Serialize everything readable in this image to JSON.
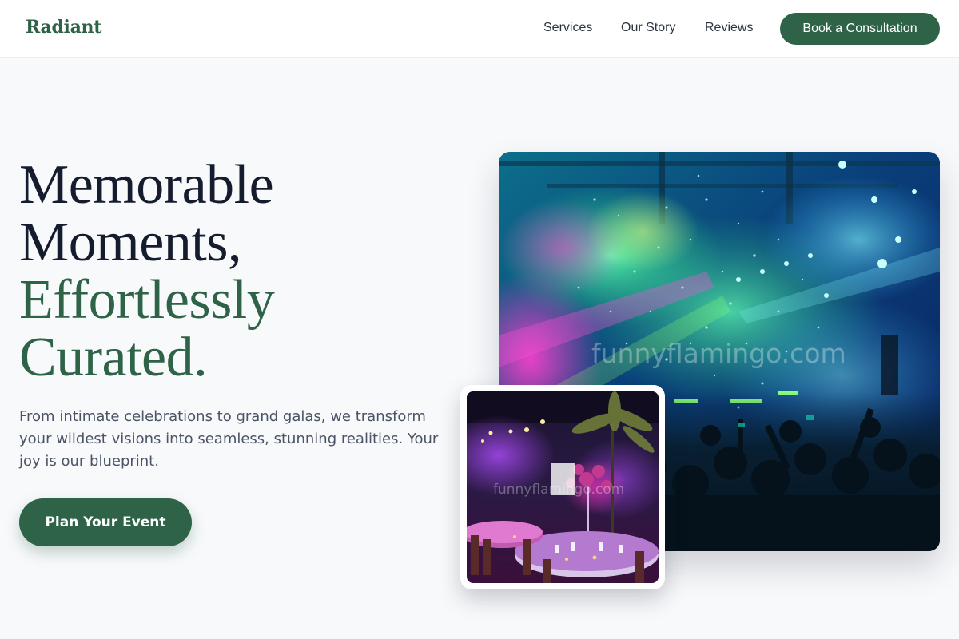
{
  "nav": {
    "brand": "Radiant",
    "links": [
      {
        "label": "Services"
      },
      {
        "label": "Our Story"
      },
      {
        "label": "Reviews"
      }
    ],
    "cta": "Book a Consultation"
  },
  "hero": {
    "title_lines": [
      "Memorable",
      "Moments,"
    ],
    "title_accent_lines": [
      "Effortlessly",
      "Curated."
    ],
    "description": "From intimate celebrations to grand galas, we transform your wildest visions into seamless, stunning realities. Your joy is our blueprint.",
    "cta": "Plan Your Event"
  },
  "images": {
    "main_watermark": "funnyflamingo.com",
    "inset_watermark": "funnyflamingo.com"
  },
  "colors": {
    "brand_green": "#2e6347",
    "heading_dark": "#141c2e",
    "body_gray": "#4a5466",
    "page_bg": "#f8f9fb"
  }
}
